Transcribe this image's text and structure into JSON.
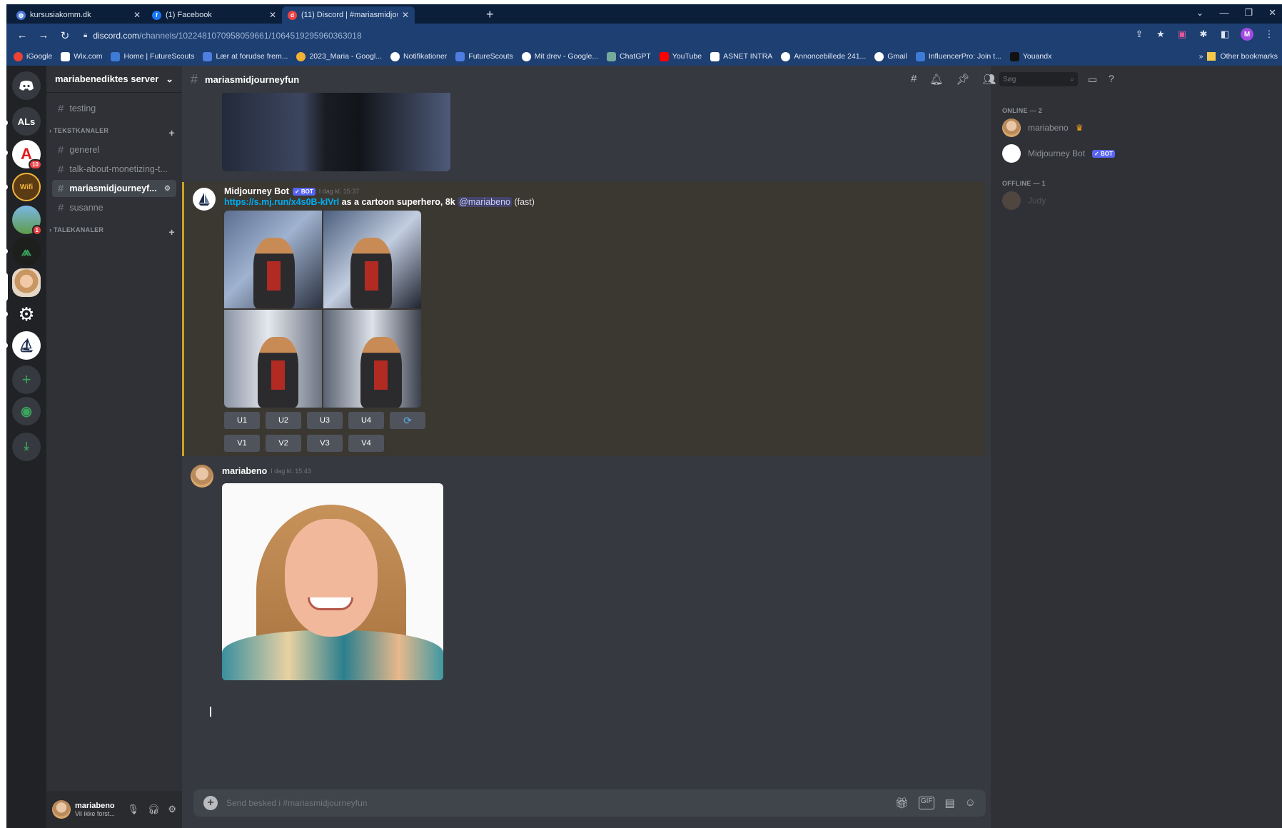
{
  "browser": {
    "tabs": [
      {
        "title": "kursusiakomm.dk",
        "icon_color": "#4b79d8",
        "active": false
      },
      {
        "title": "(1) Facebook",
        "icon_color": "#1877f2",
        "active": false
      },
      {
        "title": "(11) Discord | #mariasmidjourne...",
        "icon_color": "#ed4245",
        "active": true
      }
    ],
    "url": {
      "host": "discord.com",
      "path": "/channels/1022481070958059661/1064519295960363018"
    },
    "bookmarks": [
      {
        "label": "iGoogle",
        "color": "#ea4335"
      },
      {
        "label": "Wix.com",
        "color": "#ffffff"
      },
      {
        "label": "Home | FutureScouts",
        "color": "#3d7bd6"
      },
      {
        "label": "Lær at forudse frem...",
        "color": "#4d7ee0"
      },
      {
        "label": "2023_Maria - Googl...",
        "color": "#f2b233"
      },
      {
        "label": "Notifikationer",
        "color": "#ffffff"
      },
      {
        "label": "FutureScouts",
        "color": "#4d7ee0"
      },
      {
        "label": "Mit drev - Google...",
        "color": "#ffffff"
      },
      {
        "label": "ChatGPT",
        "color": "#74aa9c"
      },
      {
        "label": "YouTube",
        "color": "#ff0000"
      },
      {
        "label": "ASNET INTRA",
        "color": "#ffffff"
      },
      {
        "label": "Annoncebillede 241...",
        "color": "#ffffff"
      },
      {
        "label": "Gmail",
        "color": "#ffffff"
      },
      {
        "label": "InfluencerPro: Join t...",
        "color": "#3d7bd6"
      },
      {
        "label": "Youandx",
        "color": "#111111"
      }
    ],
    "other_bookmarks": "Other bookmarks",
    "profile_initial": "M"
  },
  "guilds": [
    {
      "name": "discord-home",
      "label": "",
      "color": "#36393f"
    },
    {
      "name": "als-server",
      "label": "ALs",
      "color": "#36393f"
    },
    {
      "name": "red-a-server",
      "label": "A",
      "color": "#ffffff",
      "badge": "10"
    },
    {
      "name": "wifi-server",
      "label": "Wifi",
      "color": "#5b3b14"
    },
    {
      "name": "landscape-server",
      "label": "",
      "color": "#5d9c4a",
      "badge": "1"
    },
    {
      "name": "dark-server",
      "label": "",
      "color": "#2a2f2a"
    },
    {
      "name": "mariabenediktes-server",
      "label": "",
      "color": "#d9b08c"
    },
    {
      "name": "openai-server",
      "label": "",
      "color": "#202225"
    },
    {
      "name": "midjourney-server",
      "label": "",
      "color": "#ffffff"
    }
  ],
  "server": {
    "name": "mariabenediktes server",
    "categories": [
      "TEKSTKANALER",
      "TALEKANALER"
    ],
    "channels": [
      "testing",
      "generel",
      "talk-about-monetizing-t...",
      "mariasmidjourneyf...",
      "susanne"
    ]
  },
  "user": {
    "name": "mariabeno",
    "status": "Vil ikke forst..."
  },
  "channel": {
    "name": "mariasmidjourneyfun",
    "composer_placeholder": "Send besked i #mariasmidjourneyfun"
  },
  "messages": {
    "bot": {
      "author": "Midjourney Bot",
      "tag": "✓ BOT",
      "timestamp": "I dag kl. 15:37",
      "link": "https://s.mj.run/x4s0B-kIVrI",
      "prompt": " as a cartoon superhero, 8k",
      "mention": "@mariabeno",
      "mode": " (fast)",
      "upscale_buttons": [
        "U1",
        "U2",
        "U3",
        "U4"
      ],
      "variation_buttons": [
        "V1",
        "V2",
        "V3",
        "V4"
      ],
      "reroll_icon": "refresh-icon"
    },
    "user": {
      "author": "mariabeno",
      "timestamp": "I dag kl. 15:43"
    }
  },
  "members": {
    "search_placeholder": "Søg",
    "online_label": "ONLINE — 2",
    "offline_label": "OFFLINE — 1",
    "online": [
      {
        "name": "mariabeno",
        "crown": "♛"
      },
      {
        "name": "Midjourney Bot",
        "tag": "✓ BOT"
      }
    ],
    "offline": [
      {
        "name": "Judy"
      }
    ]
  },
  "colors": {
    "accent": "#5865f2",
    "link": "#00aff4",
    "highlight": "#c9a227",
    "notification": "#ed4245"
  }
}
